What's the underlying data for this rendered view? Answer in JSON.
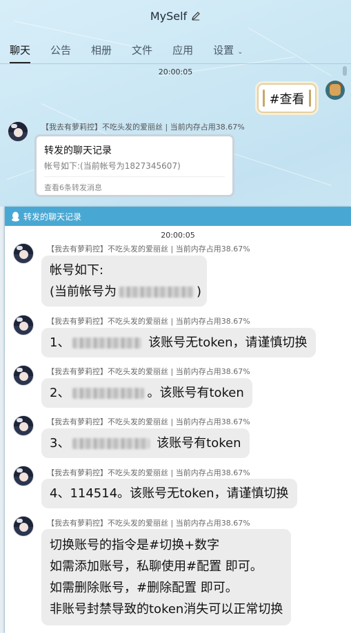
{
  "window": {
    "title": "MySelf",
    "tabs": [
      {
        "label": "聊天",
        "active": true
      },
      {
        "label": "公告"
      },
      {
        "label": "相册"
      },
      {
        "label": "文件"
      },
      {
        "label": "应用"
      },
      {
        "label": "设置"
      }
    ]
  },
  "chat": {
    "time": "20:00:05",
    "my_message": "#查看",
    "sender": "【我去有萝莉控】不吃头发的爱丽丝 | 当前内存占用38.67%",
    "forward_card": {
      "title": "转发的聊天记录",
      "preview": "帐号如下:(当前帐号为1827345607)",
      "footer": "查看6条转发消息"
    }
  },
  "popup": {
    "title": "转发的聊天记录",
    "time": "20:00:05",
    "messages": [
      {
        "sender": "【我去有萝莉控】不吃头发的爱丽丝 | 当前内存占用38.67%",
        "line1": "帐号如下:",
        "line2_prefix": "(当前帐号为",
        "line2_suffix": ")"
      },
      {
        "sender": "【我去有萝莉控】不吃头发的爱丽丝 | 当前内存占用38.67%",
        "prefix": "1、",
        "suffix": " 该账号无token，请谨慎切换"
      },
      {
        "sender": "【我去有萝莉控】不吃头发的爱丽丝 | 当前内存占用38.67%",
        "prefix": "2、",
        "suffix": "。该账号有token"
      },
      {
        "sender": "【我去有萝莉控】不吃头发的爱丽丝 | 当前内存占用38.67%",
        "prefix": "3、",
        "suffix": " 该账号有token"
      },
      {
        "sender": "【我去有萝莉控】不吃头发的爱丽丝 | 当前内存占用38.67%",
        "text": "4、114514。该账号无token，请谨慎切换"
      },
      {
        "sender": "【我去有萝莉控】不吃头发的爱丽丝 | 当前内存占用38.67%",
        "lines": [
          "切换账号的指令是#切换+数字",
          "如需添加账号，私聊使用#配置 即可。",
          "如需删除账号，#删除配置 即可。",
          "非账号封禁导致的token消失可以正常切换"
        ]
      }
    ]
  },
  "icons": [
    "edit-icon",
    "chevron-down-icon",
    "qq-penguin-icon",
    "avatar"
  ],
  "colors": {
    "popup_header": "#49a8d3",
    "bubble": "#ececec",
    "card_border": "#c9d3db"
  }
}
